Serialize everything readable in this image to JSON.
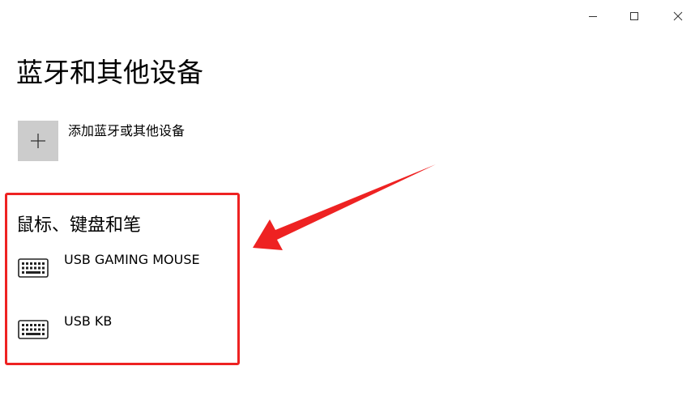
{
  "window_controls": {
    "minimize": "minimize-icon",
    "maximize": "maximize-icon",
    "close": "close-icon"
  },
  "page": {
    "title": "蓝牙和其他设备"
  },
  "add_device": {
    "icon": "plus-icon",
    "label": "添加蓝牙或其他设备"
  },
  "section": {
    "title": "鼠标、键盘和笔",
    "devices": [
      {
        "name": "USB GAMING MOUSE",
        "icon": "keyboard-icon"
      },
      {
        "name": "USB KB",
        "icon": "keyboard-icon"
      }
    ]
  },
  "annotation": {
    "color": "#ee2222"
  },
  "colors": {
    "tile_background": "#cccccc",
    "background": "#ffffff"
  }
}
